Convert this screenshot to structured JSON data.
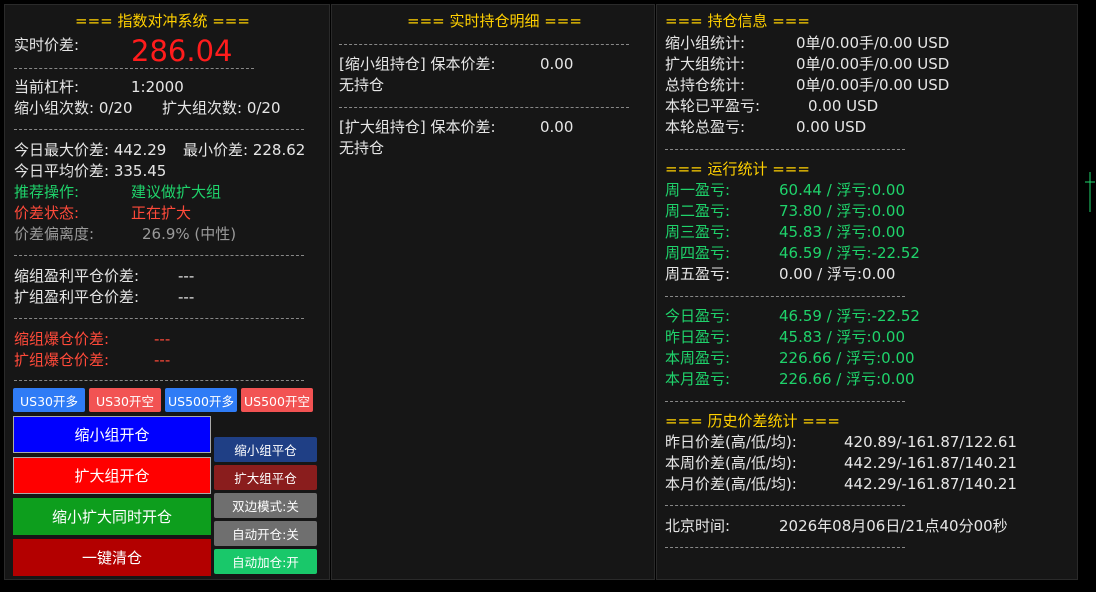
{
  "panel1": {
    "title": "=== 指数对冲系统 ===",
    "spread_label": "实时价差:",
    "spread_value": "286.04",
    "leverage_label": "当前杠杆:",
    "leverage_value": "1:2000",
    "shrink_count": "缩小组次数: 0/20",
    "expand_count": "扩大组次数: 0/20",
    "today_max": "今日最大价差: 442.29",
    "today_min": "最小价差: 228.62",
    "today_avg": "今日平均价差: 335.45",
    "recommend_label": "推荐操作:",
    "recommend_value": "建议做扩大组",
    "state_label": "价差状态:",
    "state_value": "正在扩大",
    "deviation_label": "价差偏离度:",
    "deviation_value": "26.9% (中性)",
    "shrink_tp_label": "缩组盈利平仓价差:",
    "shrink_tp_value": "---",
    "expand_tp_label": "扩组盈利平仓价差:",
    "expand_tp_value": "---",
    "shrink_liq_label": "缩组爆仓价差:",
    "shrink_liq_value": "---",
    "expand_liq_label": "扩组爆仓价差:",
    "expand_liq_value": "---",
    "buttons": {
      "us30_long": "US30开多",
      "us30_short": "US30开空",
      "us500_long": "US500开多",
      "us500_short": "US500开空",
      "shrink_open": "缩小组开仓",
      "expand_open": "扩大组开仓",
      "both_open": "缩小扩大同时开仓",
      "close_all": "一键清仓",
      "shrink_close": "缩小组平仓",
      "expand_close": "扩大组平仓",
      "dual_mode": "双边模式:关",
      "auto_open": "自动开仓:关",
      "auto_add": "自动加仓:开"
    }
  },
  "panel2": {
    "title": "=== 实时持仓明细 ===",
    "shrink_header": "[缩小组持仓] 保本价差:",
    "shrink_breakeven": "0.00",
    "shrink_empty": "无持仓",
    "expand_header": "[扩大组持仓] 保本价差:",
    "expand_breakeven": "0.00",
    "expand_empty": "无持仓"
  },
  "panel3": {
    "position_title": "=== 持仓信息 ===",
    "shrink_stat_label": "缩小组统计:",
    "shrink_stat_value": "0单/0.00手/0.00 USD",
    "expand_stat_label": "扩大组统计:",
    "expand_stat_value": "0单/0.00手/0.00 USD",
    "total_stat_label": "总持仓统计:",
    "total_stat_value": "0单/0.00手/0.00 USD",
    "closed_pl_label": "本轮已平盈亏:",
    "closed_pl_value": "0.00 USD",
    "total_pl_label": "本轮总盈亏:",
    "total_pl_value": "0.00 USD",
    "run_title": "=== 运行统计 ===",
    "weekdays": [
      {
        "label": "周一盈亏:",
        "value": "60.44 / 浮亏:0.00"
      },
      {
        "label": "周二盈亏:",
        "value": "73.80 / 浮亏:0.00"
      },
      {
        "label": "周三盈亏:",
        "value": "45.83 / 浮亏:0.00"
      },
      {
        "label": "周四盈亏:",
        "value": "46.59 / 浮亏:-22.52"
      },
      {
        "label": "周五盈亏:",
        "value": "0.00 / 浮亏:0.00"
      }
    ],
    "periods": [
      {
        "label": "今日盈亏:",
        "value": "46.59 / 浮亏:-22.52"
      },
      {
        "label": "昨日盈亏:",
        "value": "45.83 / 浮亏:0.00"
      },
      {
        "label": "本周盈亏:",
        "value": "226.66 / 浮亏:0.00"
      },
      {
        "label": "本月盈亏:",
        "value": "226.66 / 浮亏:0.00"
      }
    ],
    "history_title": "=== 历史价差统计 ===",
    "history": [
      {
        "label": "昨日价差(高/低/均):",
        "value": "420.89/-161.87/122.61"
      },
      {
        "label": "本周价差(高/低/均):",
        "value": "442.29/-161.87/140.21"
      },
      {
        "label": "本月价差(高/低/均):",
        "value": "442.29/-161.87/140.21"
      }
    ],
    "time_label": "北京时间:",
    "time_value": "2026年08月06日/21点40分00秒"
  },
  "colors": {
    "title": "#ffd000",
    "positive": "#1fd36b",
    "negative": "#ff4a3a",
    "spread": "#ff1c1c",
    "btn_blue": "#2f7cf6",
    "btn_red": "#f25353",
    "btn_big_blue": "#0000ff",
    "btn_big_red": "#ff0000",
    "btn_big_green": "#0d9e1d",
    "btn_big_darkred": "#b30000",
    "btn_navy": "#1f3f85",
    "btn_maroon": "#8a1d1d",
    "btn_gray": "#6f6f6f",
    "btn_green": "#19c86a"
  }
}
